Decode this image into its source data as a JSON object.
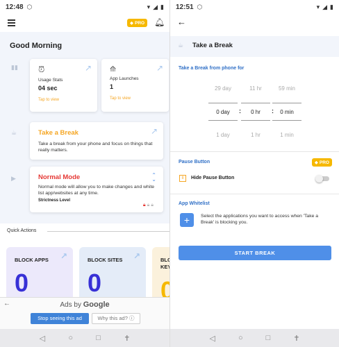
{
  "left": {
    "status": {
      "time": "12:48"
    },
    "header": {
      "pro_label": "PRO"
    },
    "greeting": "Good Morning",
    "usage_card": {
      "title": "Usage Stats",
      "value": "04 sec",
      "tap": "Tap to view"
    },
    "launch_card": {
      "title": "App Launches",
      "value": "1",
      "tap": "Tap to view"
    },
    "break_card": {
      "title": "Take a Break",
      "description": "Take a break from your phone and focus on things that really matters."
    },
    "mode_card": {
      "title": "Normal Mode",
      "description": "Normal mode will allow you to make changes and white list app/websites at any time.",
      "strictness_label": "Strictness Level"
    },
    "quick_actions": {
      "title": "Quick Actions",
      "cards": [
        {
          "label": "BLOCK APPS",
          "value": "0",
          "color": "#ece9fb"
        },
        {
          "label": "BLOCK SITES",
          "value": "0",
          "color": "#e4ecf8"
        },
        {
          "label": "BLO KEY",
          "value": "0",
          "color": "#fbf1dc"
        }
      ]
    },
    "ad": {
      "ads_by": "Ads by",
      "brand": "Google",
      "stop_button": "Stop seeing this ad",
      "why_button": "Why this ad?",
      "info_icon": "info-icon"
    }
  },
  "right": {
    "status": {
      "time": "12:51"
    },
    "title": "Take a Break",
    "picker_title": "Take a Break from phone for",
    "picker": {
      "days": {
        "above": "29 day",
        "selected": "0 day",
        "below": "1 day"
      },
      "hours": {
        "above": "11 hr",
        "selected": "0 hr",
        "below": "1 hr"
      },
      "minutes": {
        "above": "59 min",
        "selected": "0 min",
        "below": "1 min"
      }
    },
    "pause": {
      "section": "Pause Button",
      "pro_label": "PRO",
      "label": "Hide Pause Button"
    },
    "whitelist": {
      "section": "App Whitelist",
      "description": "Select the applications you want to access when 'Take a Break' is blocking you."
    },
    "start_button": "START BREAK"
  },
  "colors": {
    "accent": "#2f6fc6",
    "pro": "#f6b800",
    "start": "#4f8fe8",
    "mode_red": "#e53935"
  }
}
